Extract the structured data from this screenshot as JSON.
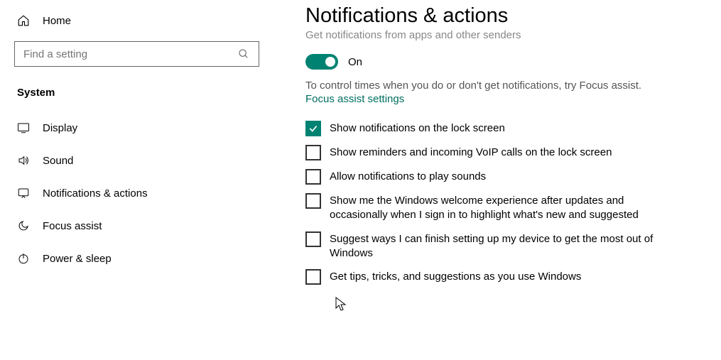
{
  "sidebar": {
    "home_label": "Home",
    "search_placeholder": "Find a setting",
    "section_label": "System",
    "items": [
      {
        "icon": "display",
        "label": "Display"
      },
      {
        "icon": "sound",
        "label": "Sound"
      },
      {
        "icon": "notifications",
        "label": "Notifications & actions"
      },
      {
        "icon": "focus",
        "label": "Focus assist"
      },
      {
        "icon": "power",
        "label": "Power & sleep"
      }
    ]
  },
  "colors": {
    "accent": "#008272"
  },
  "main": {
    "title": "Notifications & actions",
    "subtitle": "Get notifications from apps and other senders",
    "toggle_state": "on",
    "toggle_label": "On",
    "focus_hint": "To control times when you do or don't get notifications, try Focus assist.",
    "focus_link": "Focus assist settings",
    "checkboxes": [
      {
        "checked": true,
        "label": "Show notifications on the lock screen"
      },
      {
        "checked": false,
        "label": "Show reminders and incoming VoIP calls on the lock screen"
      },
      {
        "checked": false,
        "label": "Allow notifications to play sounds"
      },
      {
        "checked": false,
        "label": "Show me the Windows welcome experience after updates and occasionally when I sign in to highlight what's new and suggested"
      },
      {
        "checked": false,
        "label": "Suggest ways I can finish setting up my device to get the most out of Windows"
      },
      {
        "checked": false,
        "label": "Get tips, tricks, and suggestions as you use Windows"
      }
    ]
  }
}
